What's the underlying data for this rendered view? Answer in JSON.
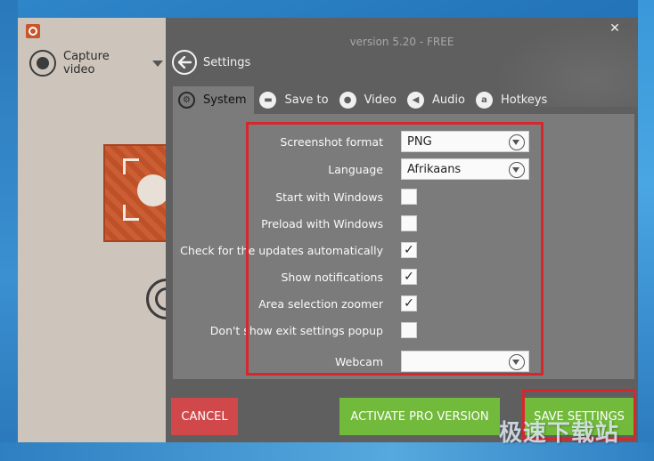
{
  "window": {
    "version": "version 5.20 - FREE",
    "close_symbol": "✕"
  },
  "recorder": {
    "capture_label": "Capture video"
  },
  "settings": {
    "title": "Settings",
    "tabs": [
      {
        "label": "System",
        "icon": "gears-icon",
        "glyph": "⚙",
        "active": true
      },
      {
        "label": "Save to",
        "icon": "folder-icon",
        "glyph": "▬",
        "active": false
      },
      {
        "label": "Video",
        "icon": "record-icon",
        "glyph": "●",
        "active": false
      },
      {
        "label": "Audio",
        "icon": "speaker-icon",
        "glyph": "◀",
        "active": false
      },
      {
        "label": "Hotkeys",
        "icon": "hotkey-icon",
        "glyph": "a",
        "active": false
      }
    ],
    "screenshot_format": {
      "label": "Screenshot format",
      "value": "PNG"
    },
    "language": {
      "label": "Language",
      "value": "Afrikaans"
    },
    "checkboxes": [
      {
        "label": "Start with Windows",
        "checked": false
      },
      {
        "label": "Preload with Windows",
        "checked": false
      },
      {
        "label": "Check for the updates automatically",
        "checked": true
      },
      {
        "label": "Show notifications",
        "checked": true
      },
      {
        "label": "Area selection zoomer",
        "checked": true
      },
      {
        "label": "Don't show exit settings popup",
        "checked": false
      }
    ],
    "webcam": {
      "label": "Webcam",
      "value": ""
    }
  },
  "buttons": {
    "cancel": "CANCEL",
    "activate_pro": "ACTIVATE PRO VERSION",
    "save": "SAVE SETTINGS"
  },
  "watermark": "极速下载站",
  "colors": {
    "panel_bg": "#5f5f5f",
    "content_bg": "#7b7b7b",
    "cancel": "#d1484a",
    "green": "#72ba3c",
    "highlight": "#d8262d",
    "brand": "#c9552a"
  }
}
